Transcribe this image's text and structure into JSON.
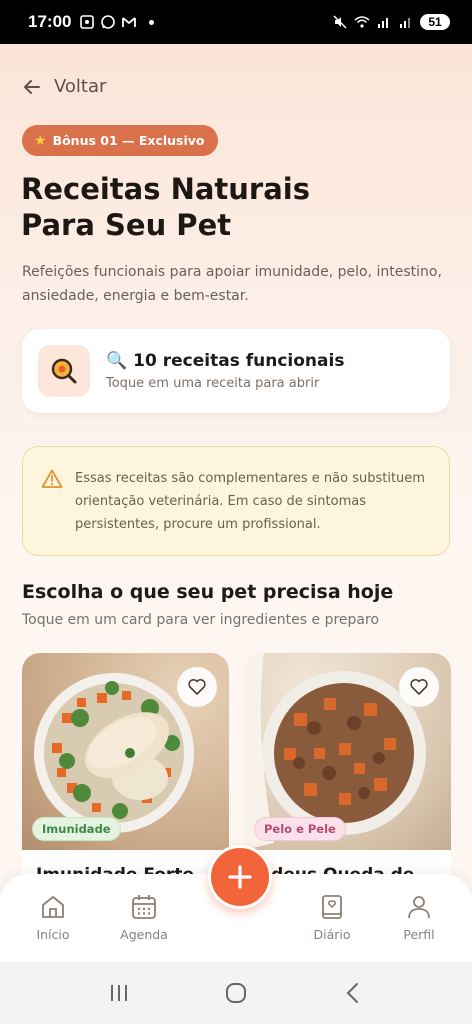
{
  "status_bar": {
    "time": "17:00",
    "battery": "51",
    "icons": [
      "screenshot-icon",
      "whatsapp-icon",
      "gmail-icon",
      "notification-dot",
      "mute-icon",
      "wifi-icon",
      "signal-icon",
      "signal-icon"
    ]
  },
  "header": {
    "back_label": "Voltar",
    "badge": "Bônus 01 — Exclusivo",
    "badge_icon": "star-icon",
    "title_line1": "Receitas Naturais",
    "title_line2": "Para Seu Pet",
    "subtitle": "Refeições funcionais para apoiar imunidade, pelo, intestino, ansiedade, energia e bem-estar."
  },
  "count_card": {
    "icon": "search-food-icon",
    "title": "10 receitas funcionais",
    "subtitle": "Toque em uma receita para abrir"
  },
  "warning": {
    "icon": "warning-icon",
    "text": "Essas receitas são complementares e não substituem orientação veterinária. Em caso de sintomas persistentes, procure um profissional."
  },
  "section": {
    "title": "Escolha o que seu pet precisa hoje",
    "subtitle": "Toque em um card para ver ingredientes e preparo"
  },
  "recipes": [
    {
      "tag": "Imunidade",
      "name": "Imunidade Forte",
      "tag_color": "#3d8a46"
    },
    {
      "tag": "Pelo e Pele",
      "name": "Adeus Queda de",
      "tag_color": "#b44c73"
    }
  ],
  "bottom_nav": {
    "items": [
      {
        "label": "Início",
        "icon": "home-icon"
      },
      {
        "label": "Agenda",
        "icon": "calendar-icon"
      },
      {
        "label": "Diário",
        "icon": "book-icon"
      },
      {
        "label": "Perfil",
        "icon": "user-icon"
      }
    ],
    "fab_icon": "plus-icon"
  },
  "colors": {
    "accent": "#f2653a",
    "badge": "#d9714a",
    "warning_bg": "#fdf5dc"
  }
}
